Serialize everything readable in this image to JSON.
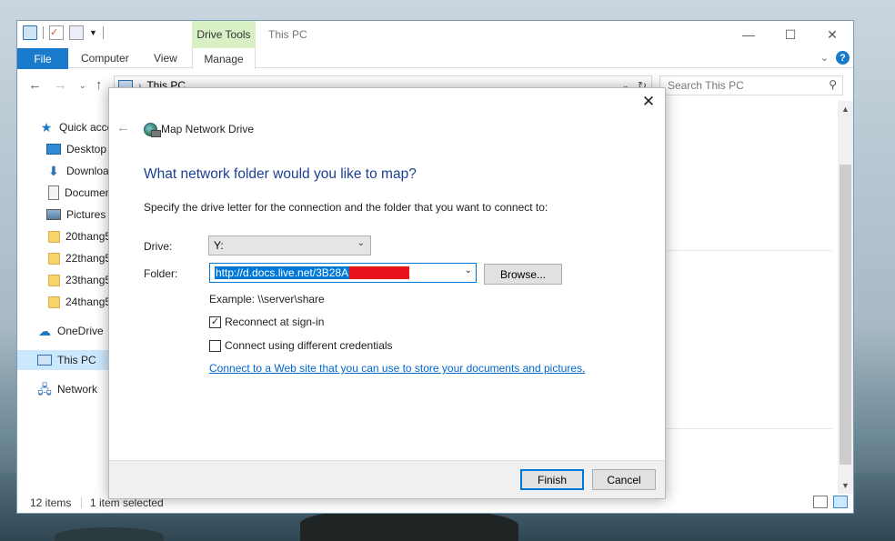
{
  "explorer": {
    "contextual_tab_group": "Drive Tools",
    "window_title": "This PC",
    "ribbon_tabs": {
      "file": "File",
      "computer": "Computer",
      "view": "View",
      "manage": "Manage"
    },
    "address": {
      "path": "This PC"
    },
    "search": {
      "placeholder": "Search This PC"
    },
    "sidebar": {
      "items": [
        {
          "label": "Quick access",
          "icon": "star-icon"
        },
        {
          "label": "Desktop",
          "icon": "desktop-icon"
        },
        {
          "label": "Downloads",
          "icon": "download-icon"
        },
        {
          "label": "Documents",
          "icon": "documents-icon"
        },
        {
          "label": "Pictures",
          "icon": "pictures-icon"
        },
        {
          "label": "20thang5",
          "icon": "folder-icon"
        },
        {
          "label": "22thang5",
          "icon": "folder-icon"
        },
        {
          "label": "23thang5",
          "icon": "folder-icon"
        },
        {
          "label": "24thang5",
          "icon": "folder-icon"
        },
        {
          "label": "OneDrive",
          "icon": "onedrive-icon"
        },
        {
          "label": "This PC",
          "icon": "this-pc-icon"
        },
        {
          "label": "Network",
          "icon": "network-icon"
        }
      ]
    },
    "status": {
      "items_count": "12 items",
      "selection": "1 item selected"
    }
  },
  "dialog": {
    "title": "Map Network Drive",
    "heading": "What network folder would you like to map?",
    "description": "Specify the drive letter for the connection and the folder that you want to connect to:",
    "drive_label": "Drive:",
    "drive_value": "Y:",
    "folder_label": "Folder:",
    "folder_value": "http://d.docs.live.net/3B28A",
    "browse_label": "Browse...",
    "example": "Example: \\\\server\\share",
    "reconnect_label": "Reconnect at sign-in",
    "reconnect_checked": true,
    "credentials_label": "Connect using different credentials",
    "credentials_checked": false,
    "link_text": "Connect to a Web site that you can use to store your documents and pictures",
    "link_tail": ".",
    "finish_label": "Finish",
    "cancel_label": "Cancel"
  },
  "colors": {
    "accent": "#0078d7",
    "file_tab": "#1979ca",
    "heading": "#1c3f94",
    "drive_tools_bg": "#d8f0c4",
    "link": "#0066cc",
    "redaction": "#e8141c"
  }
}
